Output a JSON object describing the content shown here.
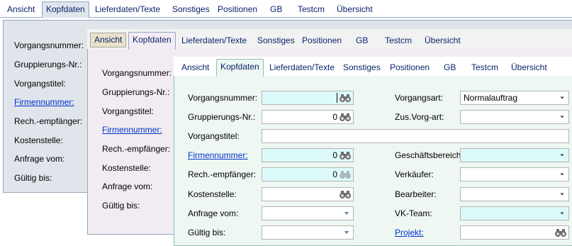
{
  "tabs": [
    "Ansicht",
    "Kopfdaten",
    "Lieferdaten/Texte",
    "Sonstiges",
    "Positionen",
    "GB",
    "Testcm",
    "Übersicht"
  ],
  "selected_tab": "Kopfdaten",
  "colors": {
    "panel_blue": "#dfe5eb",
    "panel_pink": "#f2ecf2",
    "panel_green": "#eef7f2",
    "cyan_field": "#ddfafa",
    "link": "#0033cc"
  },
  "left_labels": [
    "Vorgangsnummer:",
    "Gruppierungs-Nr.:",
    "Vorgangstitel:",
    "Firmennummer:",
    "Rech.-empfänger:",
    "Kostenstelle:",
    "Anfrage vom:",
    "Gültig bis:"
  ],
  "front": {
    "fields": {
      "vorgangsnummer": {
        "label": "Vorgangsnummer:",
        "value": ""
      },
      "gruppierung": {
        "label": "Gruppierungs-Nr.:",
        "value": "0"
      },
      "vorgangstitel": {
        "label": "Vorgangstitel:",
        "value": ""
      },
      "firmennummer": {
        "label": "Firmennummer:",
        "value": "0"
      },
      "rechempfaenger": {
        "label": "Rech.-empfänger:",
        "value": "0"
      },
      "kostenstelle": {
        "label": "Kostenstelle:",
        "value": ""
      },
      "anfrage": {
        "label": "Anfrage vom:",
        "value": ""
      },
      "gueltig": {
        "label": "Gültig bis:",
        "value": ""
      }
    },
    "right_fields": {
      "vorgangsart": {
        "label": "Vorgangsart:",
        "value": "Normalauftrag"
      },
      "zusvorgart": {
        "label": "Zus.Vorg-art:",
        "value": ""
      },
      "geschaeftsbereich": {
        "label": "Geschäftsbereich:",
        "value": ""
      },
      "verkaeufer": {
        "label": "Verkäufer:",
        "value": ""
      },
      "bearbeiter": {
        "label": "Bearbeiter:",
        "value": ""
      },
      "vkteam": {
        "label": "VK-Team:",
        "value": ""
      },
      "projekt": {
        "label": "Projekt:",
        "value": ""
      }
    }
  }
}
